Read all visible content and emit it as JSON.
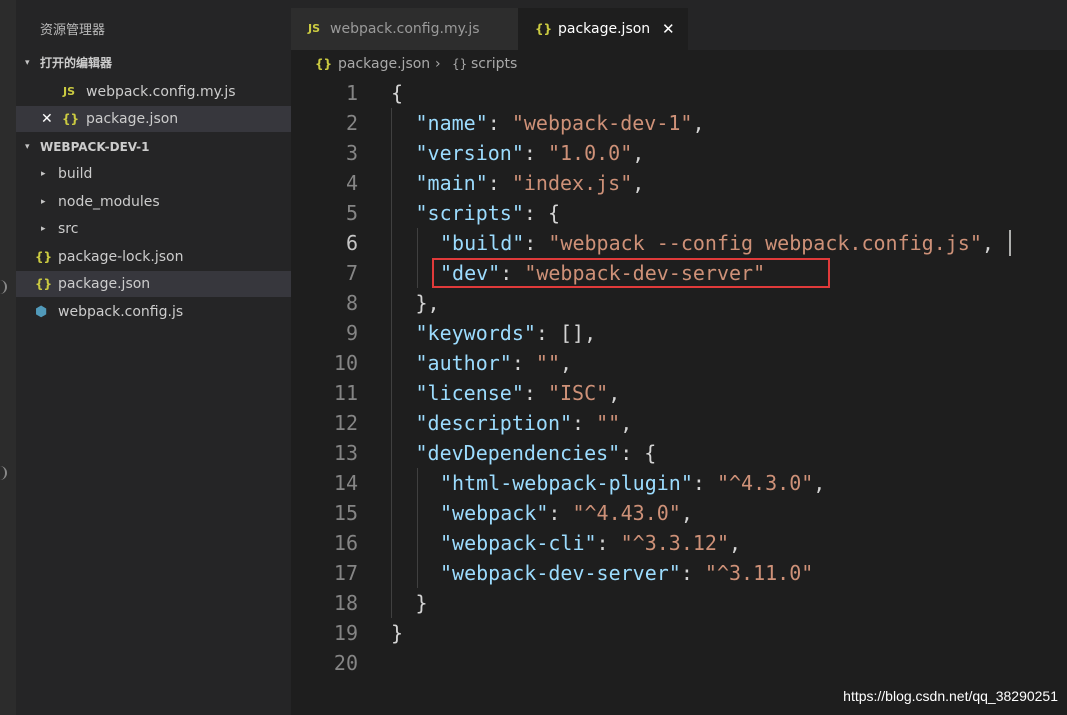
{
  "explorer": {
    "title": "资源管理器",
    "open_editors_label": "打开的编辑器",
    "open_editors": [
      {
        "icon": "JS",
        "name": "webpack.config.my.js"
      },
      {
        "icon": "{}",
        "name": "package.json",
        "close_glyph": "✕"
      }
    ],
    "project_label": "WEBPACK-DEV-1",
    "tree": [
      {
        "type": "folder",
        "name": "build"
      },
      {
        "type": "folder",
        "name": "node_modules"
      },
      {
        "type": "folder",
        "name": "src"
      },
      {
        "type": "json",
        "icon": "{}",
        "name": "package-lock.json"
      },
      {
        "type": "json",
        "icon": "{}",
        "name": "package.json"
      },
      {
        "type": "js",
        "icon": "cube-icon",
        "name": "webpack.config.js"
      }
    ]
  },
  "tabs": [
    {
      "icon": "JS",
      "label": "webpack.config.my.js"
    },
    {
      "icon": "{}",
      "label": "package.json",
      "close_glyph": "✕"
    }
  ],
  "breadcrumb": {
    "file_icon": "{}",
    "file": "package.json",
    "separator": "›",
    "symbol_icon": "{}",
    "symbol": "scripts"
  },
  "editor": {
    "current_line": 6,
    "lines": [
      {
        "n": "1",
        "tokens": [
          {
            "t": "p",
            "v": "{"
          }
        ]
      },
      {
        "n": "2",
        "tokens": [
          {
            "t": "k",
            "v": "\"name\""
          },
          {
            "t": "p",
            "v": ": "
          },
          {
            "t": "s",
            "v": "\"webpack-dev-1\""
          },
          {
            "t": "p",
            "v": ","
          }
        ]
      },
      {
        "n": "3",
        "tokens": [
          {
            "t": "k",
            "v": "\"version\""
          },
          {
            "t": "p",
            "v": ": "
          },
          {
            "t": "s",
            "v": "\"1.0.0\""
          },
          {
            "t": "p",
            "v": ","
          }
        ]
      },
      {
        "n": "4",
        "tokens": [
          {
            "t": "k",
            "v": "\"main\""
          },
          {
            "t": "p",
            "v": ": "
          },
          {
            "t": "s",
            "v": "\"index.js\""
          },
          {
            "t": "p",
            "v": ","
          }
        ]
      },
      {
        "n": "5",
        "tokens": [
          {
            "t": "k",
            "v": "\"scripts\""
          },
          {
            "t": "p",
            "v": ": {"
          }
        ]
      },
      {
        "n": "6",
        "tokens": [
          {
            "t": "k",
            "v": "\"build\""
          },
          {
            "t": "p",
            "v": ": "
          },
          {
            "t": "s",
            "v": "\"webpack --config webpack.config.js\""
          },
          {
            "t": "p",
            "v": ","
          }
        ]
      },
      {
        "n": "7",
        "tokens": [
          {
            "t": "k",
            "v": "\"dev\""
          },
          {
            "t": "p",
            "v": ": "
          },
          {
            "t": "s",
            "v": "\"webpack-dev-server\""
          }
        ]
      },
      {
        "n": "8",
        "tokens": [
          {
            "t": "p",
            "v": "},"
          }
        ]
      },
      {
        "n": "9",
        "tokens": [
          {
            "t": "k",
            "v": "\"keywords\""
          },
          {
            "t": "p",
            "v": ": [],"
          }
        ]
      },
      {
        "n": "10",
        "tokens": [
          {
            "t": "k",
            "v": "\"author\""
          },
          {
            "t": "p",
            "v": ": "
          },
          {
            "t": "s",
            "v": "\"\""
          },
          {
            "t": "p",
            "v": ","
          }
        ]
      },
      {
        "n": "11",
        "tokens": [
          {
            "t": "k",
            "v": "\"license\""
          },
          {
            "t": "p",
            "v": ": "
          },
          {
            "t": "s",
            "v": "\"ISC\""
          },
          {
            "t": "p",
            "v": ","
          }
        ]
      },
      {
        "n": "12",
        "tokens": [
          {
            "t": "k",
            "v": "\"description\""
          },
          {
            "t": "p",
            "v": ": "
          },
          {
            "t": "s",
            "v": "\"\""
          },
          {
            "t": "p",
            "v": ","
          }
        ]
      },
      {
        "n": "13",
        "tokens": [
          {
            "t": "k",
            "v": "\"devDependencies\""
          },
          {
            "t": "p",
            "v": ": {"
          }
        ]
      },
      {
        "n": "14",
        "tokens": [
          {
            "t": "k",
            "v": "\"html-webpack-plugin\""
          },
          {
            "t": "p",
            "v": ": "
          },
          {
            "t": "s",
            "v": "\"^4.3.0\""
          },
          {
            "t": "p",
            "v": ","
          }
        ]
      },
      {
        "n": "15",
        "tokens": [
          {
            "t": "k",
            "v": "\"webpack\""
          },
          {
            "t": "p",
            "v": ": "
          },
          {
            "t": "s",
            "v": "\"^4.43.0\""
          },
          {
            "t": "p",
            "v": ","
          }
        ]
      },
      {
        "n": "16",
        "tokens": [
          {
            "t": "k",
            "v": "\"webpack-cli\""
          },
          {
            "t": "p",
            "v": ": "
          },
          {
            "t": "s",
            "v": "\"^3.3.12\""
          },
          {
            "t": "p",
            "v": ","
          }
        ]
      },
      {
        "n": "17",
        "tokens": [
          {
            "t": "k",
            "v": "\"webpack-dev-server\""
          },
          {
            "t": "p",
            "v": ": "
          },
          {
            "t": "s",
            "v": "\"^3.11.0\""
          }
        ]
      },
      {
        "n": "18",
        "tokens": [
          {
            "t": "p",
            "v": "}"
          }
        ]
      },
      {
        "n": "19",
        "tokens": [
          {
            "t": "p",
            "v": "}"
          }
        ]
      },
      {
        "n": "20",
        "tokens": []
      }
    ]
  },
  "watermark": "https://blog.csdn.net/qq_38290251",
  "colors": {
    "key": "#9cdcfe",
    "string": "#ce9178",
    "punctuation": "#d4d4d4",
    "highlight_box": "#e03a3a"
  }
}
